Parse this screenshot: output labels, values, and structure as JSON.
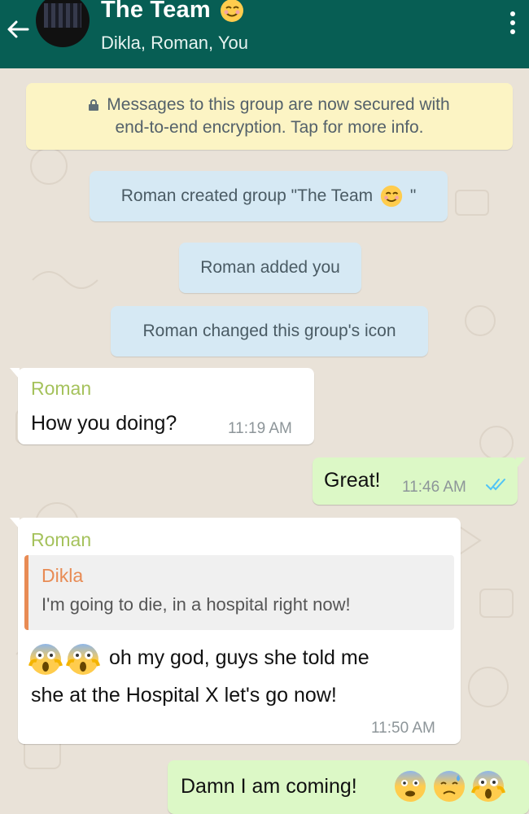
{
  "header": {
    "title": "The Team",
    "subtitle": "Dikla, Roman, You",
    "title_emoji": "smiling-emoji",
    "color": "#075e54"
  },
  "system": {
    "encryption": [
      "Messages to this group are now secured with",
      "end-to-end encryption. Tap for more info."
    ],
    "created": "Roman created group \"The Team",
    "created_end": "\"",
    "added": "Roman added you",
    "changed_icon": "Roman changed this group's icon"
  },
  "messages": [
    {
      "sender": "Roman",
      "text": "How you doing?",
      "time": "11:19 AM",
      "direction": "incoming"
    },
    {
      "text": "Great!",
      "time": "11:46 AM",
      "direction": "outgoing",
      "status": "read"
    },
    {
      "sender": "Roman",
      "quote": {
        "name": "Dikla",
        "text": "I'm going to die, in a hospital right now!"
      },
      "lines": [
        "oh my god, guys she told me",
        "she at the Hospital X let's go now!"
      ],
      "emojis": [
        "screaming-face-emoji",
        "screaming-face-emoji"
      ],
      "time": "11:50 AM",
      "direction": "incoming"
    },
    {
      "text": "Damn I am coming!",
      "emojis": [
        "anxious-face-emoji",
        "sweat-face-emoji",
        "screaming-face-emoji"
      ],
      "direction": "outgoing"
    }
  ],
  "colors": {
    "sender_name": "#a5c25c",
    "quote_accent": "#e88b54",
    "outgoing_bubble": "#dcf8c6",
    "read_ticks": "#4fc3f7"
  }
}
